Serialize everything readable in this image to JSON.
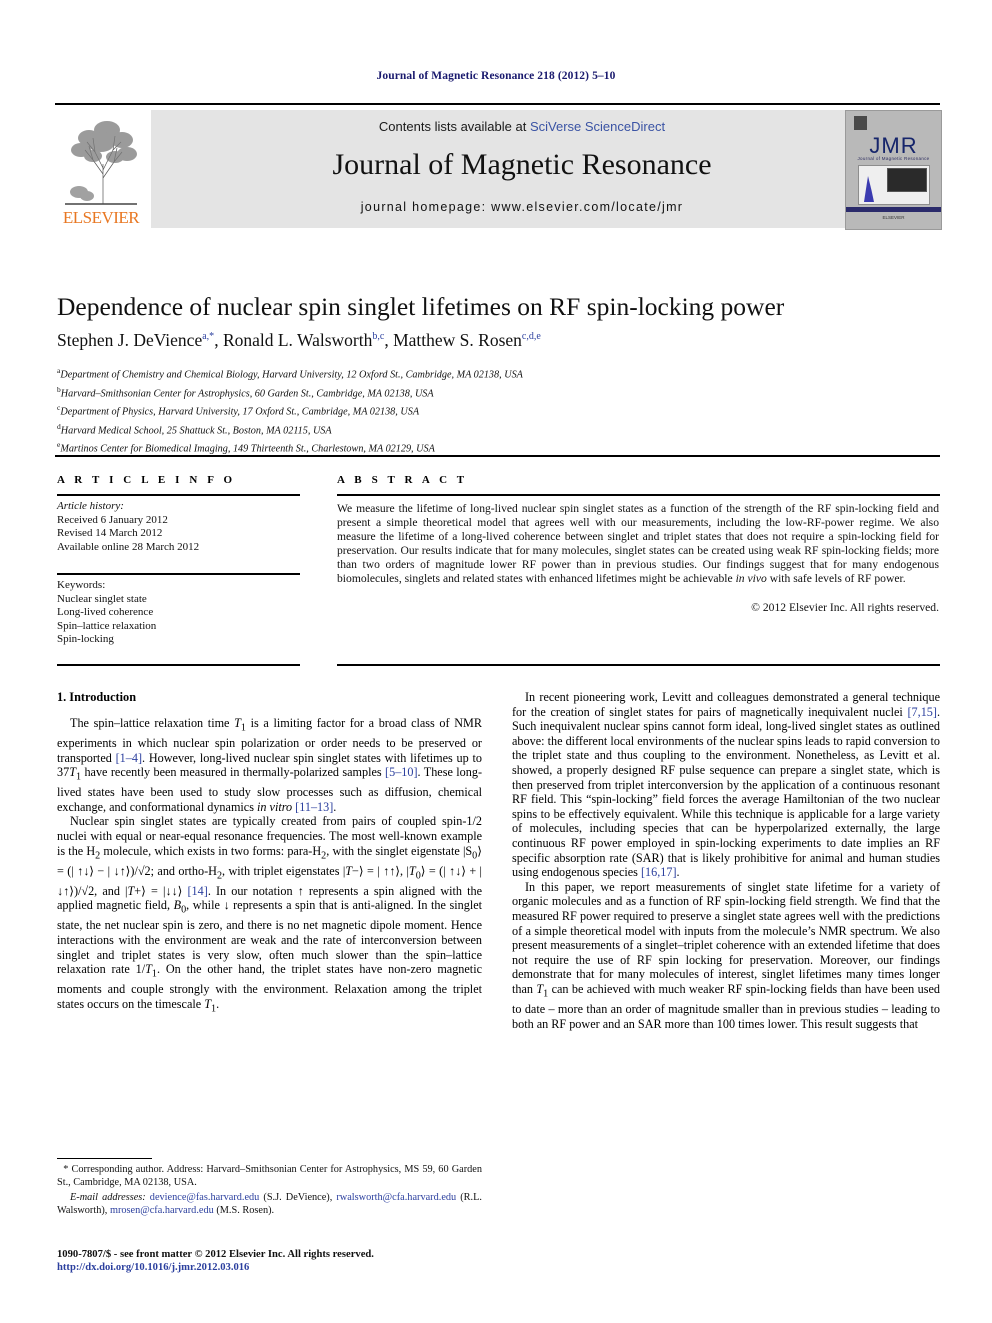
{
  "running_head": "Journal of Magnetic Resonance 218 (2012) 5–10",
  "masthead": {
    "publisher": "ELSEVIER",
    "contents_prefix": "Contents lists available at ",
    "contents_link": "SciVerse ScienceDirect",
    "journal_title": "Journal of Magnetic Resonance",
    "homepage": "journal homepage: www.elsevier.com/locate/jmr",
    "cover": {
      "title": "JMR",
      "subtitle": "Journal of Magnetic Resonance",
      "footer": "ELSEVIER"
    }
  },
  "article": {
    "title": "Dependence of nuclear spin singlet lifetimes on RF spin-locking power",
    "authors": [
      {
        "name": "Stephen J. DeVience",
        "marks": "a,*"
      },
      {
        "name": "Ronald L. Walsworth",
        "marks": "b,c"
      },
      {
        "name": "Matthew S. Rosen",
        "marks": "c,d,e"
      }
    ],
    "affiliations": [
      {
        "mark": "a",
        "text": "Department of Chemistry and Chemical Biology, Harvard University, 12 Oxford St., Cambridge, MA 02138, USA"
      },
      {
        "mark": "b",
        "text": "Harvard–Smithsonian Center for Astrophysics, 60 Garden St., Cambridge, MA 02138, USA"
      },
      {
        "mark": "c",
        "text": "Department of Physics, Harvard University, 17 Oxford St., Cambridge, MA 02138, USA"
      },
      {
        "mark": "d",
        "text": "Harvard Medical School, 25 Shattuck St., Boston, MA 02115, USA"
      },
      {
        "mark": "e",
        "text": "Martinos Center for Biomedical Imaging, 149 Thirteenth St., Charlestown, MA 02129, USA"
      }
    ]
  },
  "info": {
    "heading": "A R T I C L E   I N F O",
    "history_label": "Article history:",
    "history": [
      "Received 6 January 2012",
      "Revised 14 March 2012",
      "Available online 28 March 2012"
    ],
    "keywords_label": "Keywords:",
    "keywords": [
      "Nuclear singlet state",
      "Long-lived coherence",
      "Spin–lattice relaxation",
      "Spin-locking"
    ]
  },
  "abstract": {
    "heading": "A B S T R A C T",
    "text": "We measure the lifetime of long-lived nuclear spin singlet states as a function of the strength of the RF spin-locking field and present a simple theoretical model that agrees well with our measurements, including the low-RF-power regime. We also measure the lifetime of a long-lived coherence between singlet and triplet states that does not require a spin-locking field for preservation. Our results indicate that for many molecules, singlet states can be created using weak RF spin-locking fields; more than two orders of magnitude lower RF power than in previous studies. Our findings suggest that for many endogenous biomolecules, singlets and related states with enhanced lifetimes might be achievable ",
    "text_italic": "in vivo",
    "text_tail": " with safe levels of RF power.",
    "copyright": "© 2012 Elsevier Inc. All rights reserved."
  },
  "body": {
    "section_heading": "1. Introduction",
    "left_paragraphs": [
      {
        "parts": [
          {
            "t": "The spin–lattice relaxation time "
          },
          {
            "t": "T",
            "style": "i"
          },
          {
            "t": "1",
            "style": "sub"
          },
          {
            "t": " is a limiting factor for a broad class of NMR experiments in which nuclear spin polarization or order needs to be preserved or transported "
          },
          {
            "t": "[1–4]",
            "style": "ref"
          },
          {
            "t": ". However, long-lived nuclear spin singlet states with lifetimes up to 37"
          },
          {
            "t": "T",
            "style": "i"
          },
          {
            "t": "1",
            "style": "sub"
          },
          {
            "t": " have recently been measured in thermally-polarized samples "
          },
          {
            "t": "[5–10]",
            "style": "ref"
          },
          {
            "t": ". These long-lived states have been used to study slow processes such as diffusion, chemical exchange, and conformational dynamics "
          },
          {
            "t": "in vitro",
            "style": "i"
          },
          {
            "t": " "
          },
          {
            "t": "[11–13]",
            "style": "ref"
          },
          {
            "t": "."
          }
        ]
      },
      {
        "parts": [
          {
            "t": "Nuclear spin singlet states are typically created from pairs of coupled spin-1/2 nuclei with equal or near-equal resonance frequencies. The most well-known example is the H"
          },
          {
            "t": "2",
            "style": "sub"
          },
          {
            "t": " molecule, which exists in two forms: para-H"
          },
          {
            "t": "2",
            "style": "sub"
          },
          {
            "t": ", with the singlet eigenstate |S"
          },
          {
            "t": "0",
            "style": "sub"
          },
          {
            "t": "⟩ = (| ↑↓⟩ − | ↓↑⟩)/√2; and ortho-H"
          },
          {
            "t": "2",
            "style": "sub"
          },
          {
            "t": ", with triplet eigenstates |"
          },
          {
            "t": "T",
            "style": "i"
          },
          {
            "t": "−⟩ = | ↑↑⟩, |"
          },
          {
            "t": "T",
            "style": "i"
          },
          {
            "t": "0",
            "style": "sub"
          },
          {
            "t": "⟩ = (| ↑↓⟩ + | ↓↑⟩)/√2, and |"
          },
          {
            "t": "T",
            "style": "i"
          },
          {
            "t": "+⟩ = |↓↓⟩ "
          },
          {
            "t": "[14]",
            "style": "ref"
          },
          {
            "t": ". In our notation ↑ represents a spin aligned with the applied magnetic field, "
          },
          {
            "t": "B",
            "style": "i"
          },
          {
            "t": "0",
            "style": "sub"
          },
          {
            "t": ", while ↓ represents a spin that is anti-aligned. In the singlet state, the net nuclear spin is zero, and there is no net magnetic dipole moment. Hence interactions with the environment are weak and the rate of interconversion between singlet and triplet states is very slow, often much slower than the spin–lattice relaxation rate 1/"
          },
          {
            "t": "T",
            "style": "i"
          },
          {
            "t": "1",
            "style": "sub"
          },
          {
            "t": ". On the other hand, the triplet states have non-zero magnetic moments and couple strongly with the environment. Relaxation among the triplet states occurs on the timescale "
          },
          {
            "t": "T",
            "style": "i"
          },
          {
            "t": "1",
            "style": "sub"
          },
          {
            "t": "."
          }
        ]
      }
    ],
    "right_paragraphs": [
      {
        "parts": [
          {
            "t": "In recent pioneering work, Levitt and colleagues demonstrated a general technique for the creation of singlet states for pairs of magnetically inequivalent nuclei "
          },
          {
            "t": "[7,15]",
            "style": "ref"
          },
          {
            "t": ". Such inequivalent nuclear spins cannot form ideal, long-lived singlet states as outlined above: the different local environments of the nuclear spins leads to rapid conversion to the triplet state and thus coupling to the environment. Nonetheless, as Levitt et al. showed, a properly designed RF pulse sequence can prepare a singlet state, which is then preserved from triplet interconversion by the application of a continuous resonant RF field. This “spin-locking” field forces the average Hamiltonian of the two nuclear spins to be effectively equivalent. While this technique is applicable for a large variety of molecules, including species that can be hyperpolarized externally, the large continuous RF power employed in spin-locking experiments to date implies an RF specific absorption rate (SAR) that is likely prohibitive for animal and human studies using endogenous species "
          },
          {
            "t": "[16,17]",
            "style": "ref"
          },
          {
            "t": "."
          }
        ]
      },
      {
        "parts": [
          {
            "t": "In this paper, we report measurements of singlet state lifetime for a variety of organic molecules and as a function of RF spin-locking field strength. We find that the measured RF power required to preserve a singlet state agrees well with the predictions of a simple theoretical model with inputs from the molecule’s NMR spectrum. We also present measurements of a singlet–triplet coherence with an extended lifetime that does not require the use of RF spin locking for preservation. Moreover, our findings demonstrate that for many molecules of interest, singlet lifetimes many times longer than "
          },
          {
            "t": "T",
            "style": "i"
          },
          {
            "t": "1",
            "style": "sub"
          },
          {
            "t": " can be achieved with much weaker RF spin-locking fields than have been used to date – more than an order of magnitude smaller than in previous studies – leading to both an RF power and an SAR more than 100 times lower. This result suggests that"
          }
        ]
      }
    ]
  },
  "footnote": {
    "corresponding_mark": "*",
    "corresponding": " Corresponding author. Address: Harvard–Smithsonian Center for Astrophysics, MS 59, 60 Garden St., Cambridge, MA 02138, USA.",
    "email_label": "E-mail addresses:",
    "emails": [
      {
        "address": "devience@fas.harvard.edu",
        "person": " (S.J. DeVience), "
      },
      {
        "address": "rwalsworth@cfa.harvard.edu",
        "person": " (R.L. Walsworth), "
      },
      {
        "address": "mrosen@cfa.harvard.edu",
        "person": " (M.S. Rosen)."
      }
    ]
  },
  "imprint": {
    "line1": "1090-7807/$ - see front matter © 2012 Elsevier Inc. All rights reserved.",
    "doi": "http://dx.doi.org/10.1016/j.jmr.2012.03.016"
  },
  "colors": {
    "link": "#2b3f9e",
    "elsevier_orange": "#E87722",
    "banner_gray": "#e4e4e4",
    "runhead_navy": "#1a1a6e"
  }
}
